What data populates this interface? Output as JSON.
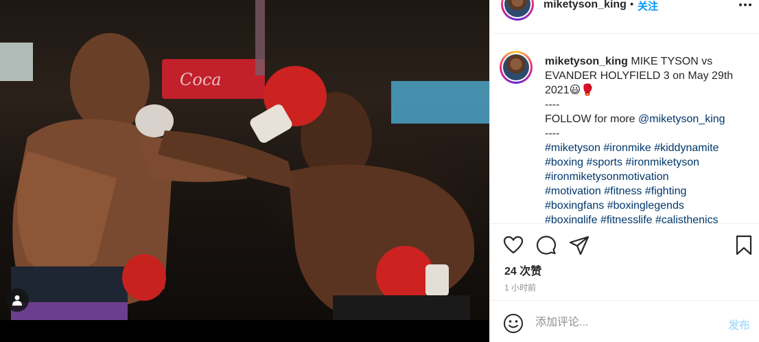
{
  "post": {
    "username": "miketyson_king",
    "header_separator": "•",
    "follow_label": "关注",
    "caption": {
      "username": "miketyson_king",
      "line1": "MIKE TYSON vs EVANDER HOLYFIELD 3 on May 29th 2021",
      "emojis": "😃🥊",
      "divider1": "----",
      "follow_text": "FOLLOW for more ",
      "follow_mention": "@miketyson_king",
      "divider2": "----",
      "hashtags": [
        "#miketyson",
        "#ironmike",
        "#kiddynamite",
        "#boxing",
        "#sports",
        "#ironmiketyson",
        "#ironmiketysonmotivation",
        "#motivation",
        "#fitness",
        "#fighting",
        "#boxingfans",
        "#boxinglegends",
        "#boxinglife",
        "#fitnesslife",
        "#calisthenics"
      ]
    },
    "likes": "24 次赞",
    "time_ago": "1 小时前"
  },
  "comment": {
    "placeholder": "添加评论...",
    "post_label": "发布"
  },
  "icons": {
    "more": "more-horizontal-icon",
    "like": "heart-icon",
    "comment": "comment-bubble-icon",
    "share": "paper-plane-icon",
    "save": "bookmark-icon",
    "emoji": "smiley-icon",
    "user_tags": "user-tag-icon"
  },
  "colors": {
    "link": "#00376b",
    "follow": "#0095f6",
    "post_disabled": "#b2dffc",
    "muted": "#8e8e8e"
  }
}
